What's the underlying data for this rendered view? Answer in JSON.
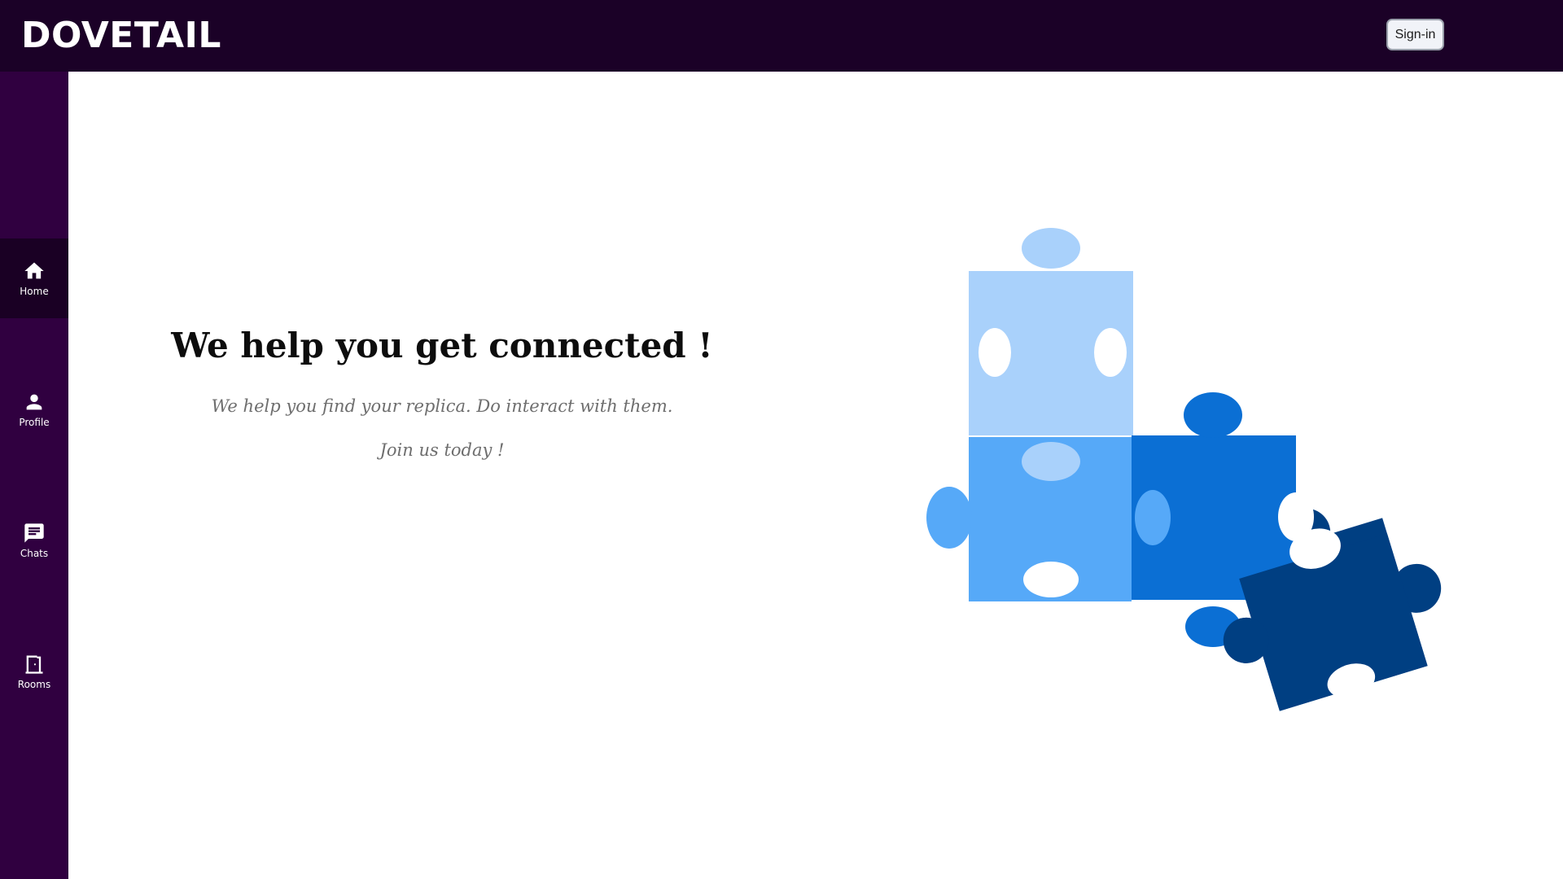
{
  "header": {
    "brand": "DOVETAIL",
    "signin_label": "Sign-in"
  },
  "sidebar": {
    "items": [
      {
        "label": "Home",
        "icon": "home-icon",
        "active": true
      },
      {
        "label": "Profile",
        "icon": "person-icon",
        "active": false
      },
      {
        "label": "Chats",
        "icon": "chat-icon",
        "active": false
      },
      {
        "label": "Rooms",
        "icon": "door-icon",
        "active": false
      }
    ]
  },
  "hero": {
    "title": "We help you get connected !",
    "subtitle": "We help you find your replica. Do interact with them.",
    "cta": "Join us today !"
  },
  "illustration": {
    "name": "puzzle-pieces-illustration",
    "colors": [
      "#a9d1fb",
      "#56a9f8",
      "#0b6fd4",
      "#003f82"
    ]
  },
  "colors": {
    "topbar": "#1b0127",
    "sidebar": "#300040",
    "sidebar_active": "#1a0024"
  }
}
